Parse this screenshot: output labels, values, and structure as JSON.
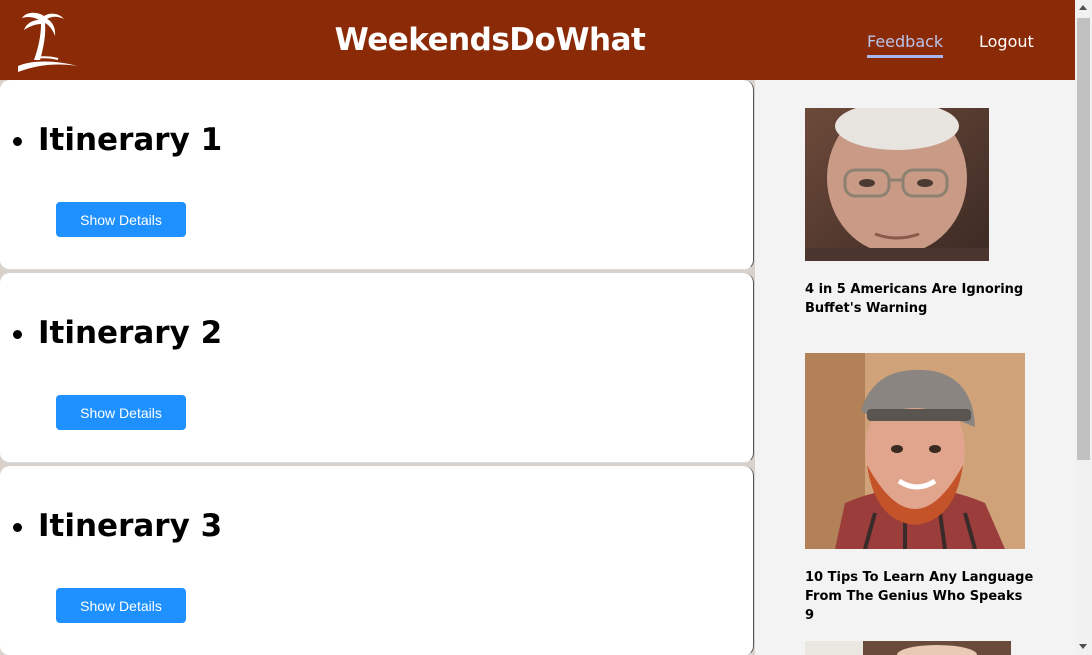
{
  "header": {
    "brand": "WeekendsDoWhat",
    "nav": {
      "feedback": "Feedback",
      "logout": "Logout"
    },
    "logo_icon": "palm-tree-icon",
    "colors": {
      "background": "#8b2a06",
      "feedback_link": "#b9c4ea"
    }
  },
  "itineraries": [
    {
      "title": "Itinerary 1",
      "button_label": "Show Details"
    },
    {
      "title": "Itinerary 2",
      "button_label": "Show Details"
    },
    {
      "title": "Itinerary 3",
      "button_label": "Show Details"
    }
  ],
  "ads": [
    {
      "title": "4 in 5 Americans Are Ignoring Buffet's Warning",
      "image": "elderly-man-glasses-photo"
    },
    {
      "title": "10 Tips To Learn Any Language From The Genius Who Speaks 9",
      "image": "bearded-man-cap-photo"
    },
    {
      "title": "",
      "image": "partial-photo"
    }
  ],
  "colors": {
    "button": "#1e90ff",
    "sidebar": "#f3f3f3"
  }
}
